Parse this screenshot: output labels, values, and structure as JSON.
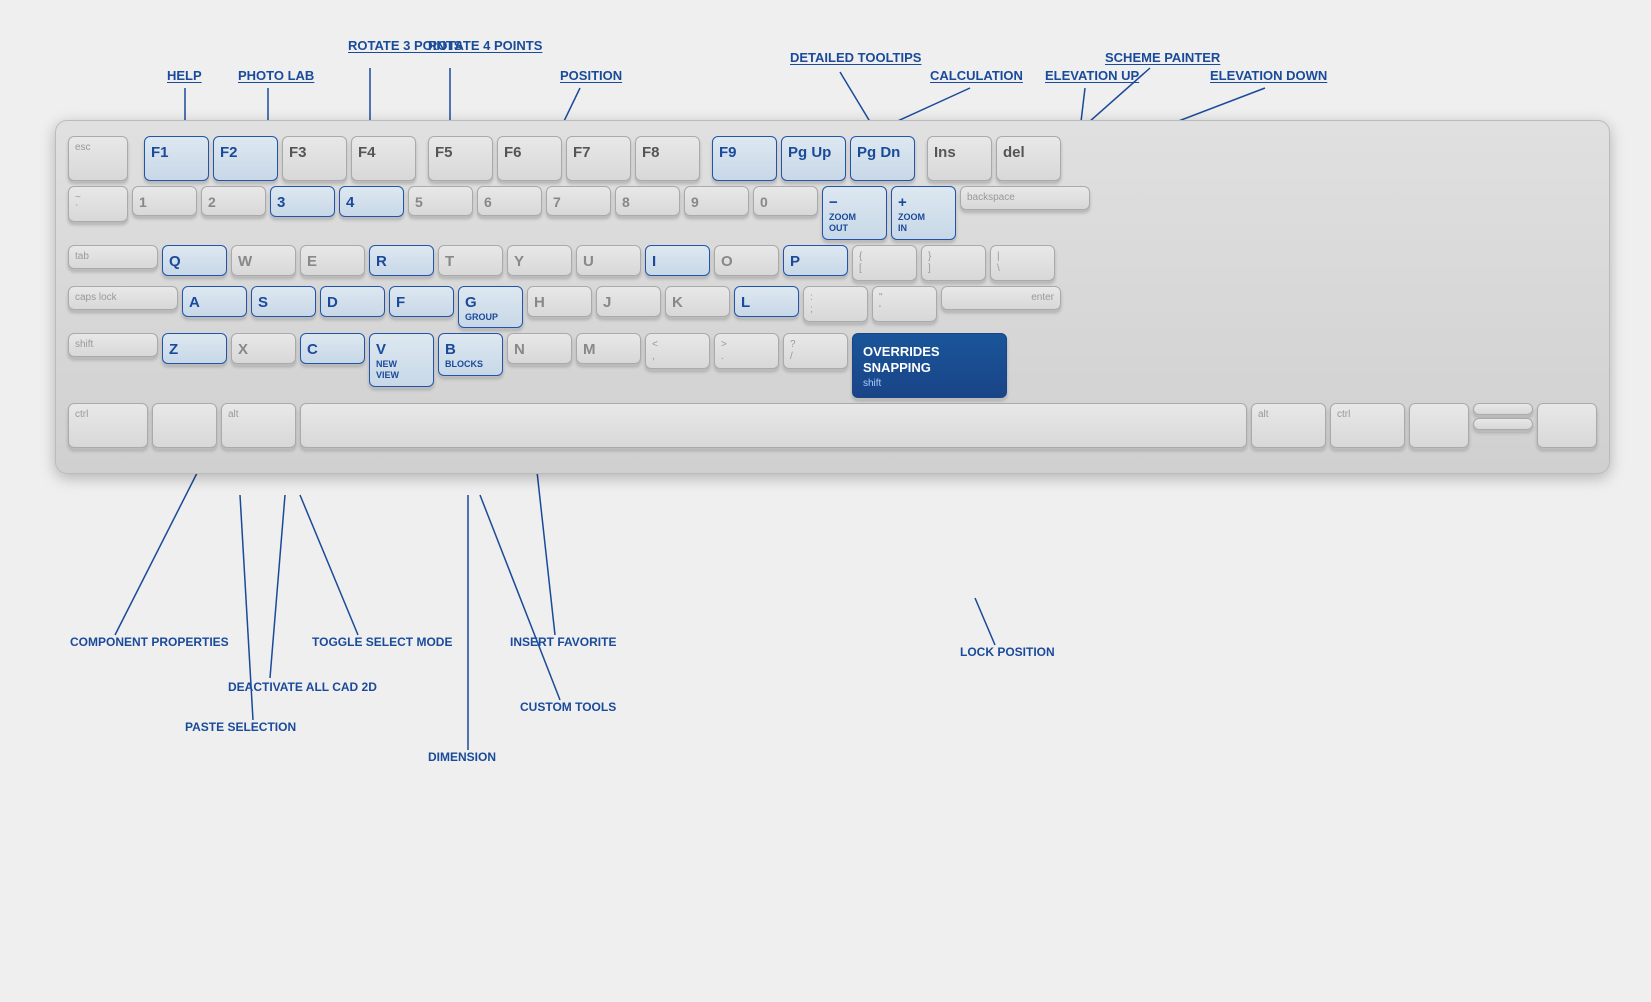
{
  "labels": {
    "help": "HELP",
    "photo_lab": "PHOTO LAB",
    "rotate_3": "ROTATE\n3 POINTS",
    "rotate_4": "ROTATE\n4 POINTS",
    "position": "POSITION",
    "detailed_tooltips": "DETAILED TOOLTIPS",
    "calculation": "CALCULATION",
    "scheme_painter": "SCHEME PAINTER",
    "elevation_up": "ELEVATION UP",
    "elevation_down": "ELEVATION DOWN",
    "zoom_out": "ZOOM\nOUT",
    "zoom_in": "ZOOM\nIN",
    "group": "GROUP",
    "new_view": "NEW\nVIEW",
    "blocks": "BLOCKS",
    "overrides_snapping": "OVERRIDES\nSNAPPING",
    "overrides_snapping_key": "shift",
    "component_properties": "COMPONENT\nPROPERTIES",
    "paste_selection": "PASTE  SELECTION",
    "deactivate_cad": "DEACTIVATE\nALL CAD 2D",
    "toggle_select": "TOGGLE  SELECT\nMODE",
    "dimension": "DIMENSION",
    "custom_tools": "CUSTOM TOOLS",
    "insert_favorite": "INSERT  FAVORITE",
    "lock_position": "LOCK\nPOSITION"
  },
  "keys": {
    "row0": [
      "esc",
      "F1",
      "F2",
      "F3",
      "F4",
      "F5",
      "F6",
      "F7",
      "F8",
      "F9",
      "Pg Up",
      "Pg Dn",
      "Ins",
      "del"
    ],
    "row1": [
      "~\n`",
      "1",
      "2",
      "3",
      "4",
      "5",
      "6",
      "7",
      "8",
      "9",
      "0",
      "−",
      "+",
      "backspace"
    ],
    "row2": [
      "tab",
      "Q",
      "W",
      "E",
      "R",
      "T",
      "Y",
      "U",
      "I",
      "O",
      "P",
      "{\n[",
      "}\n]",
      "|\n\\"
    ],
    "row3": [
      "caps lock",
      "A",
      "S",
      "D",
      "F",
      "G",
      "H",
      "J",
      "K",
      "L",
      ":",
      "\"",
      "enter"
    ],
    "row4": [
      "shift",
      "Z",
      "X",
      "C",
      "V",
      "B",
      "N",
      "M",
      "<\n,",
      ">\n.",
      "?\n/",
      "OVERRIDES\nSNAPPING"
    ],
    "row5": [
      "ctrl",
      "",
      "alt",
      "",
      "",
      "",
      "",
      "",
      "",
      "alt",
      "ctrl",
      "",
      "",
      ""
    ]
  },
  "colors": {
    "accent": "#1a4a9a",
    "key_highlight_bg": "#dde8f0",
    "key_normal_bg": "#e0e0e0",
    "overrides_bg": "#1a5599",
    "text_normal": "#888888",
    "text_highlight": "#1a4a9a"
  }
}
